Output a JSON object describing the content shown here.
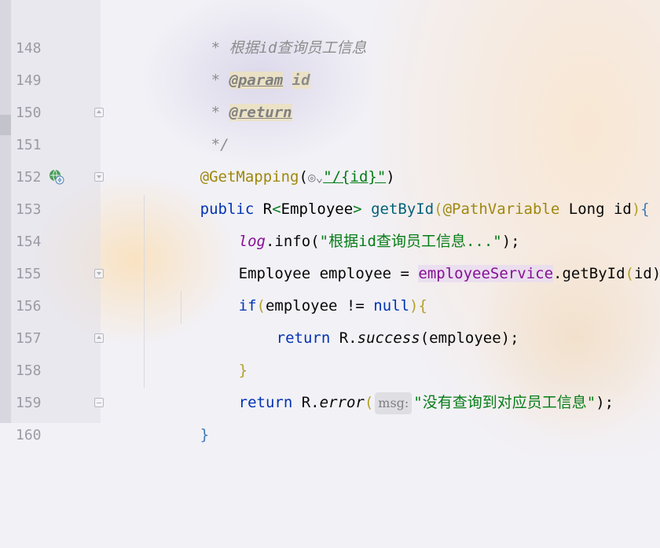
{
  "editor": {
    "theme_colors": {
      "keyword": "#0033b3",
      "string": "#067d17",
      "annotation": "#9e880d",
      "method_def": "#00627a",
      "field": "#871094",
      "comment": "#8c8c8c",
      "line_number": "#9b9ba6"
    },
    "lines": [
      {
        "num": "148",
        "t1": "* ",
        "t2": "根据id查询员工信息"
      },
      {
        "num": "149",
        "t1": "* ",
        "tag": "@param",
        "t2": "id"
      },
      {
        "num": "150",
        "t1": "* ",
        "tag": "@return"
      },
      {
        "num": "151",
        "t1": "*/"
      },
      {
        "num": "152",
        "ann": "@GetMapping",
        "p1": "(",
        "str": "\"/{id}\"",
        "p2": ")",
        "icon": "globe-icon"
      },
      {
        "num": "153",
        "kw": "public",
        "t1": "R",
        "lt": "<",
        "t2": "Employee",
        "gt": ">",
        "m": "getById",
        "p1": "(",
        "ann": "@PathVariable",
        "t3": "Long id",
        "p2": ")",
        "b": "{",
        "gutter_icon": "web-endpoint-icon"
      },
      {
        "num": "154",
        "f": "log",
        "dot": ".",
        "m": "info",
        "p1": "(",
        "str": "\"根据id查询员工信息...\"",
        "p2": ");"
      },
      {
        "num": "155",
        "t1": "Employee employee = ",
        "f": "employeeService",
        "t2": ".getById",
        "p1": "(",
        "t3": "id",
        "p2": ");"
      },
      {
        "num": "156",
        "kw": "if",
        "p1": "(",
        "t1": "employee != ",
        "kw2": "null",
        "p2": ")",
        "b": "{"
      },
      {
        "num": "157",
        "kw": "return",
        "t1": "R.",
        "m": "success",
        "p1": "(",
        "t2": "employee",
        "p2": ");"
      },
      {
        "num": "158",
        "b": "}"
      },
      {
        "num": "159",
        "kw": "return",
        "t1": "R.",
        "m": "error",
        "p1": "(",
        "hint": "msg:",
        "str": "\"没有查询到对应员工信息\"",
        "p2": ");"
      },
      {
        "num": "160",
        "b": "}"
      }
    ]
  }
}
